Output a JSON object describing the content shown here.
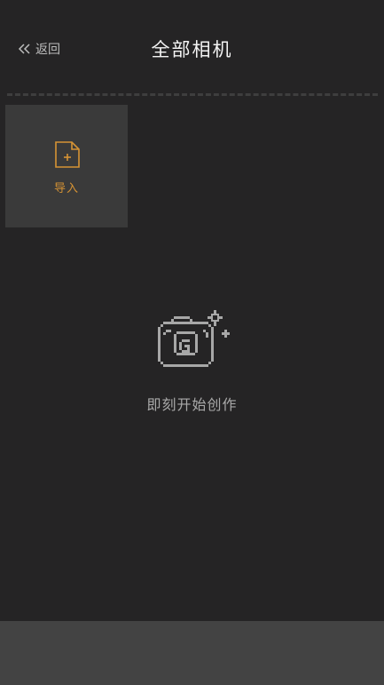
{
  "header": {
    "back_label": "返回",
    "title": "全部相机"
  },
  "import_tile": {
    "label": "导入",
    "icon": "file-plus-icon"
  },
  "empty_state": {
    "icon": "pixel-camera-sparkle-icon",
    "text": "即刻开始创作"
  },
  "colors": {
    "background": "#252425",
    "tile": "#3a3a3a",
    "accent": "#d69334",
    "bottom_bar": "#434343"
  }
}
